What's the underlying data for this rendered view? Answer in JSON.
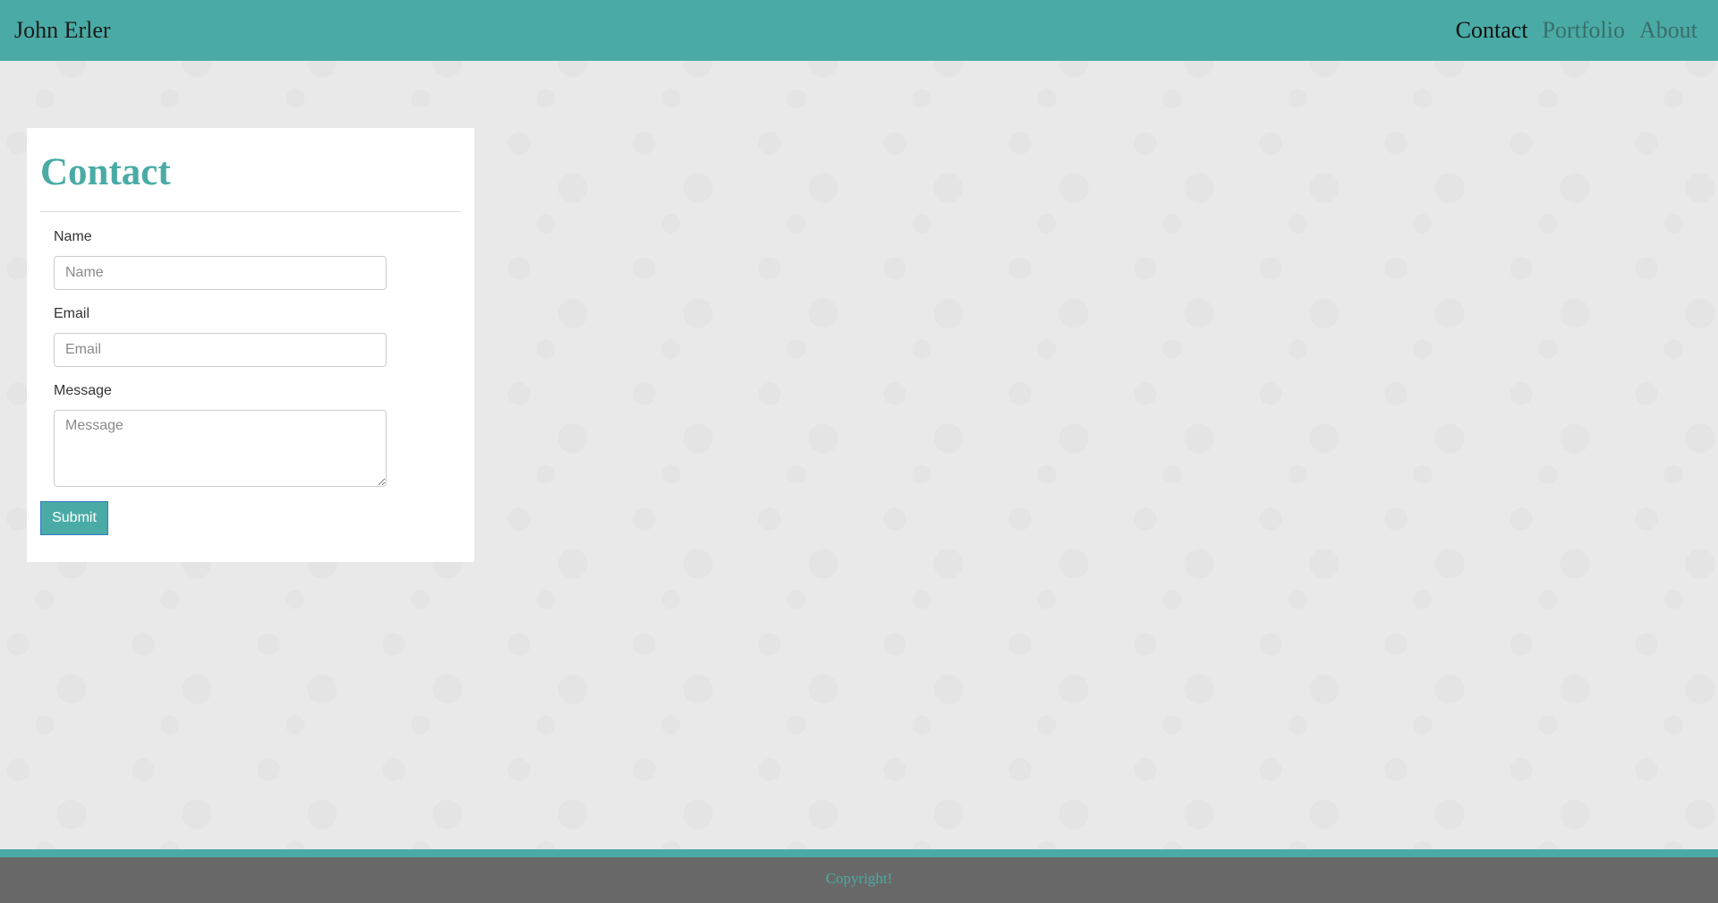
{
  "navbar": {
    "brand": "John Erler",
    "links": [
      {
        "label": "Contact",
        "active": true
      },
      {
        "label": "Portfolio",
        "active": false
      },
      {
        "label": "About",
        "active": false
      }
    ]
  },
  "contact": {
    "title": "Contact",
    "fields": {
      "name": {
        "label": "Name",
        "placeholder": "Name",
        "value": ""
      },
      "email": {
        "label": "Email",
        "placeholder": "Email",
        "value": ""
      },
      "message": {
        "label": "Message",
        "placeholder": "Message",
        "value": ""
      }
    },
    "submit_label": "Submit"
  },
  "footer": {
    "copyright": "Copyright!"
  },
  "colors": {
    "accent": "#4aaba6",
    "footer_bg": "#686868",
    "page_bg": "#e9e9e9"
  }
}
